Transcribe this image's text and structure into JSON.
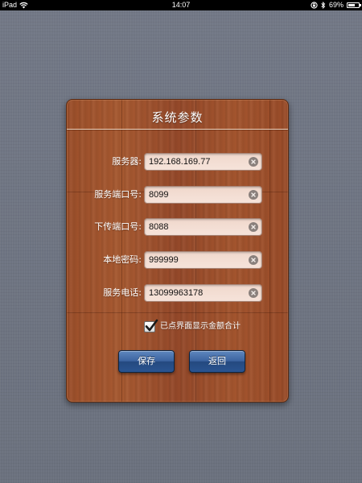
{
  "status_bar": {
    "device": "iPad",
    "time": "14:07",
    "battery_percent": "69%",
    "battery_level": 0.69
  },
  "dialog": {
    "title": "系统参数",
    "fields": [
      {
        "label": "服务器:",
        "value": "192.168.169.77"
      },
      {
        "label": "服务端口号:",
        "value": "8099"
      },
      {
        "label": "下传端口号:",
        "value": "8088"
      },
      {
        "label": "本地密码:",
        "value": "999999"
      },
      {
        "label": "服务电话:",
        "value": "13099963178"
      }
    ],
    "checkbox": {
      "label": "已点界面显示金额合计",
      "checked": true
    },
    "buttons": {
      "save": "保存",
      "back": "返回"
    }
  },
  "colors": {
    "background": "#6f7582",
    "wood": "#9b4f29",
    "button": "#2a5490",
    "field": "#f4e0d6"
  },
  "icons": [
    "wifi-icon",
    "lock-rotation-icon",
    "bluetooth-icon",
    "battery-icon",
    "clear-icon",
    "checkmark-icon"
  ]
}
